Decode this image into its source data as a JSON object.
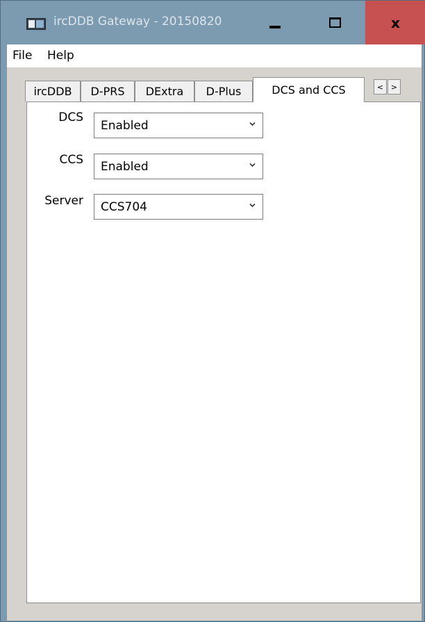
{
  "window": {
    "title": "ircDDB Gateway - 20150820",
    "icon": "app-window-icon",
    "buttons": {
      "minimize_icon": "minimize-icon",
      "maximize_icon": "maximize-icon",
      "close_label": "x"
    },
    "colors": {
      "titlebar": "#7d9bb0",
      "close": "#c75050"
    }
  },
  "menu": {
    "items": [
      {
        "label": "File"
      },
      {
        "label": "Help"
      }
    ]
  },
  "tabs": [
    {
      "label": "ircDDB",
      "active": false
    },
    {
      "label": "D-PRS",
      "active": false
    },
    {
      "label": "DExtra",
      "active": false
    },
    {
      "label": "D-Plus",
      "active": false
    },
    {
      "label": "DCS and CCS",
      "active": true
    }
  ],
  "tab_scroll": {
    "left": "<",
    "right": ">"
  },
  "form": {
    "dcs": {
      "label": "DCS",
      "value": "Enabled"
    },
    "ccs": {
      "label": "CCS",
      "value": "Enabled"
    },
    "server": {
      "label": "Server",
      "value": "CCS704"
    }
  }
}
